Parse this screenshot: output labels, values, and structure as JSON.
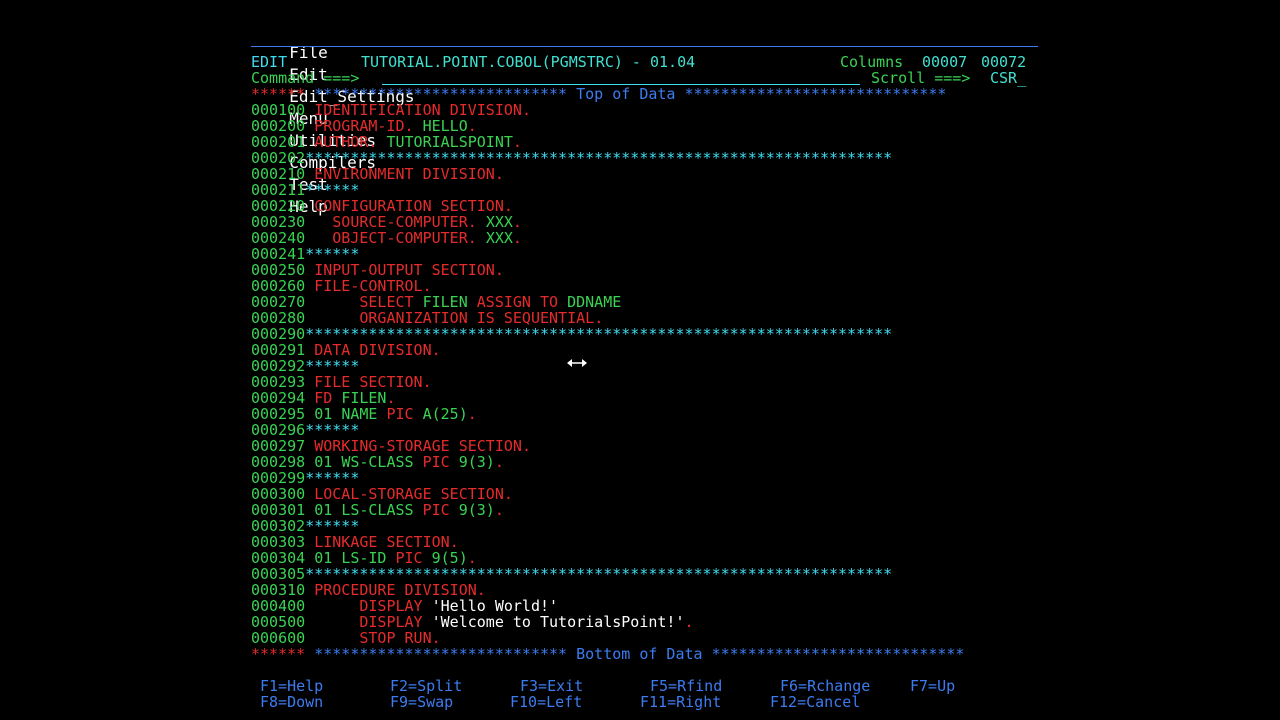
{
  "menu": [
    "File",
    "Edit",
    "Edit_Settings",
    "Menu",
    "Utilities",
    "Compilers",
    "Test",
    "Help"
  ],
  "header": {
    "mode": "EDIT",
    "dataset": "TUTORIAL.POINT.COBOL(PGMSTRC) - 01.04",
    "columns_label": "Columns",
    "col_start": "00007",
    "col_end": "00072",
    "command_label": "Command ===>",
    "scroll_label": "Scroll ===>",
    "scroll_value": "CSR"
  },
  "top_marker": "Top of Data",
  "bottom_marker": "Bottom of Data",
  "lines": [
    {
      "num": "000100",
      "text": "IDENTIFICATION DIVISION.",
      "type": "code"
    },
    {
      "num": "000200",
      "text": "PROGRAM-ID. HELLO.",
      "type": "code"
    },
    {
      "num": "000201",
      "text": "AUTHOR. TUTORIALSPOINT.",
      "type": "code"
    },
    {
      "num": "000202",
      "text": "*****************************************************************",
      "type": "comment"
    },
    {
      "num": "000210",
      "text": "ENVIRONMENT DIVISION.",
      "type": "code"
    },
    {
      "num": "000211",
      "text": "******",
      "type": "comment"
    },
    {
      "num": "000220",
      "text": "CONFIGURATION SECTION.",
      "type": "code"
    },
    {
      "num": "000230",
      "text": "  SOURCE-COMPUTER. XXX.",
      "type": "code"
    },
    {
      "num": "000240",
      "text": "  OBJECT-COMPUTER. XXX.",
      "type": "code"
    },
    {
      "num": "000241",
      "text": "******",
      "type": "comment"
    },
    {
      "num": "000250",
      "text": "INPUT-OUTPUT SECTION.",
      "type": "code"
    },
    {
      "num": "000260",
      "text": "FILE-CONTROL.",
      "type": "code"
    },
    {
      "num": "000270",
      "text": "     SELECT FILEN ASSIGN TO DDNAME",
      "type": "code"
    },
    {
      "num": "000280",
      "text": "     ORGANIZATION IS SEQUENTIAL.",
      "type": "code"
    },
    {
      "num": "000290",
      "text": "*****************************************************************",
      "type": "comment"
    },
    {
      "num": "000291",
      "text": "DATA DIVISION.",
      "type": "code"
    },
    {
      "num": "000292",
      "text": "******",
      "type": "comment"
    },
    {
      "num": "000293",
      "text": "FILE SECTION.",
      "type": "code"
    },
    {
      "num": "000294",
      "text": "FD FILEN.",
      "type": "code"
    },
    {
      "num": "000295",
      "text": "01 NAME PIC A(25).",
      "type": "code"
    },
    {
      "num": "000296",
      "text": "******",
      "type": "comment"
    },
    {
      "num": "000297",
      "text": "WORKING-STORAGE SECTION.",
      "type": "code"
    },
    {
      "num": "000298",
      "text": "01 WS-CLASS PIC 9(3).",
      "type": "code"
    },
    {
      "num": "000299",
      "text": "******",
      "type": "comment"
    },
    {
      "num": "000300",
      "text": "LOCAL-STORAGE SECTION.",
      "type": "code"
    },
    {
      "num": "000301",
      "text": "01 LS-CLASS PIC 9(3).",
      "type": "code"
    },
    {
      "num": "000302",
      "text": "******",
      "type": "comment"
    },
    {
      "num": "000303",
      "text": "LINKAGE SECTION.",
      "type": "code"
    },
    {
      "num": "000304",
      "text": "01 LS-ID PIC 9(5).",
      "type": "code"
    },
    {
      "num": "000305",
      "text": "*****************************************************************",
      "type": "comment"
    },
    {
      "num": "000310",
      "text": "PROCEDURE DIVISION.",
      "type": "code"
    },
    {
      "num": "000400",
      "text": "     DISPLAY 'Hello World!'",
      "type": "code"
    },
    {
      "num": "000500",
      "text": "     DISPLAY 'Welcome to TutorialsPoint!'.",
      "type": "code"
    },
    {
      "num": "000600",
      "text": "     STOP RUN.",
      "type": "code"
    }
  ],
  "pfkeys_row1": [
    "F1=Help",
    "F2=Split",
    "F3=Exit",
    "F5=Rfind",
    "F6=Rchange",
    "F7=Up"
  ],
  "pfkeys_row2": [
    "F8=Down",
    "F9=Swap",
    "F10=Left",
    "F11=Right",
    "F12=Cancel"
  ],
  "colors": {
    "red": "#e52b2b",
    "green": "#39d353",
    "cyan": "#3fdcef",
    "blue": "#3c7cf0"
  }
}
